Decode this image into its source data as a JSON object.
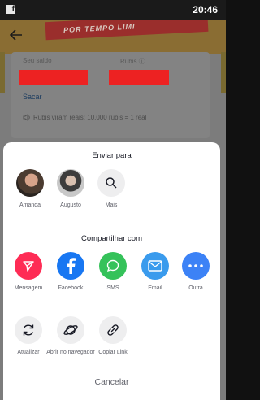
{
  "status_bar": {
    "time": "20:46"
  },
  "background": {
    "banner_text": "POR TEMPO LIMI",
    "balance_label": "Seu saldo",
    "rubis_label": "Rubis ⓘ",
    "withdraw_label": "Sacar",
    "note": "Rubis viram reais: 10.000 rubis = 1 real"
  },
  "sheet": {
    "send_to_title": "Enviar para",
    "contacts": [
      {
        "name": "Amanda"
      },
      {
        "name": "Augusto"
      },
      {
        "name": "Mais"
      }
    ],
    "share_title": "Compartilhar com",
    "share_apps": [
      {
        "label": "Mensagem",
        "color": "#fe2c55"
      },
      {
        "label": "Facebook",
        "color": "#1877f2"
      },
      {
        "label": "SMS",
        "color": "#35c25a"
      },
      {
        "label": "Email",
        "color": "#3a9bed"
      },
      {
        "label": "Outra",
        "color": "#3c82f6"
      }
    ],
    "actions": [
      {
        "label": "Atualizar"
      },
      {
        "label": "Abrir no navegador"
      },
      {
        "label": "Copiar Link"
      }
    ],
    "cancel_label": "Cancelar"
  }
}
